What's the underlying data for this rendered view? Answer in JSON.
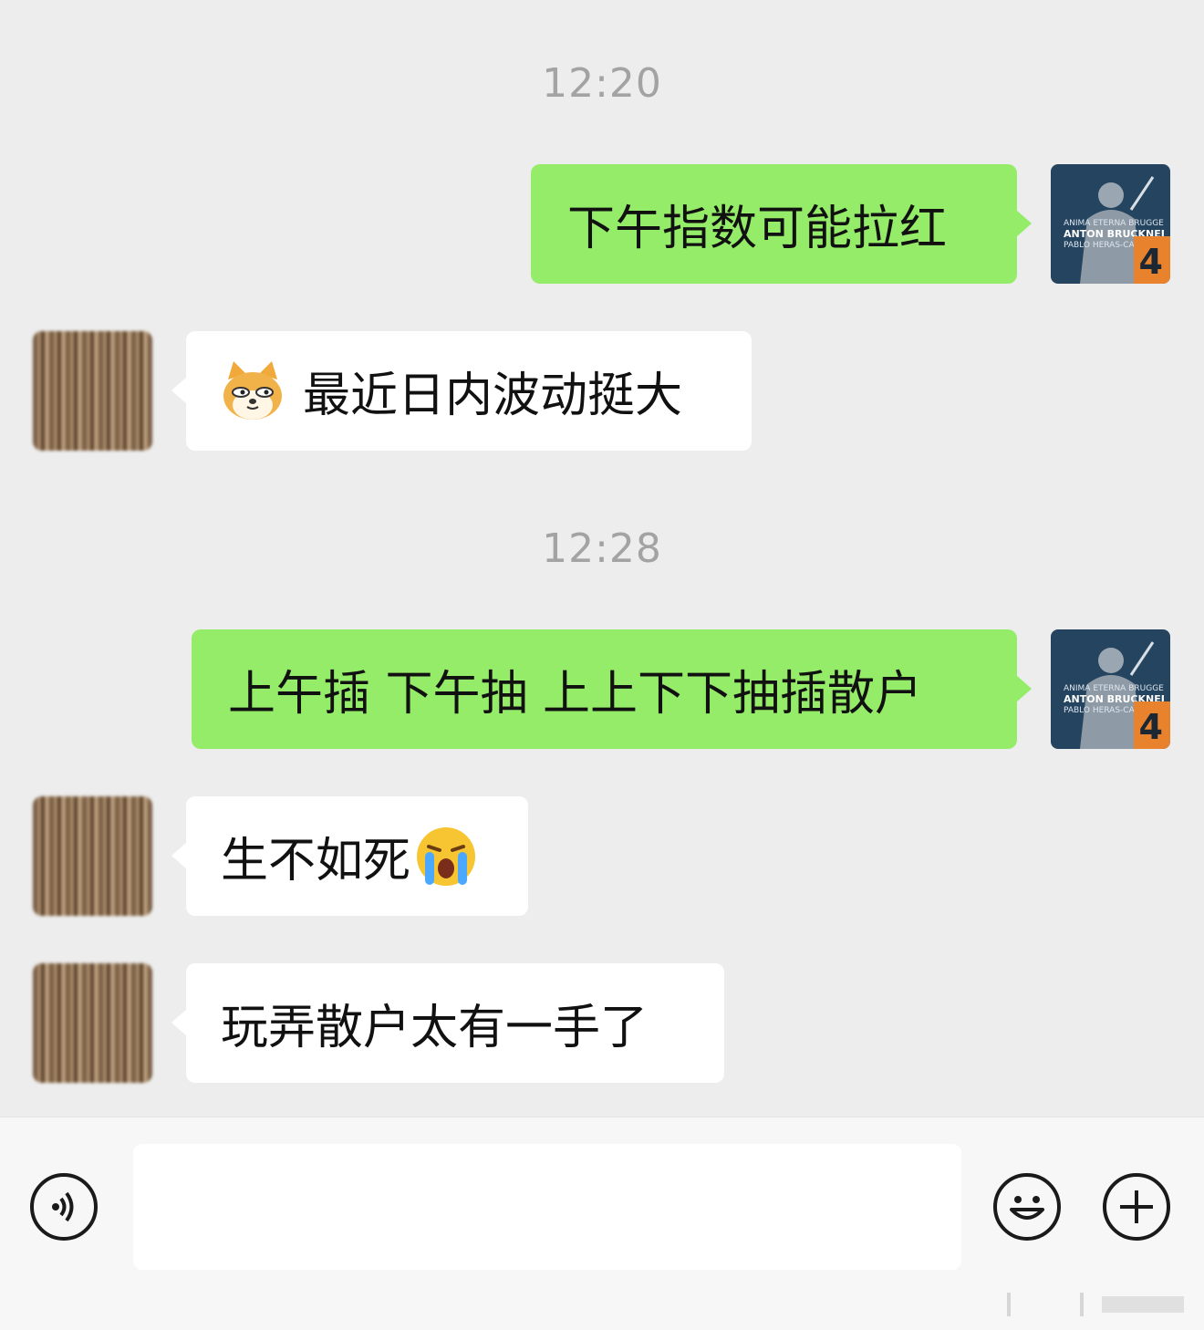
{
  "messages": [
    {
      "kind": "timestamp",
      "text": "12:20"
    },
    {
      "kind": "outgoing",
      "text": "下午指数可能拉红"
    },
    {
      "kind": "incoming",
      "emoji": "doge-cat-emoji",
      "text": "最近日内波动挺大"
    },
    {
      "kind": "timestamp",
      "text": "12:28"
    },
    {
      "kind": "outgoing",
      "text": "上午插 下午抽 上上下下抽插散户"
    },
    {
      "kind": "incoming",
      "text": "生不如死",
      "emoji": "loudly-crying-emoji"
    },
    {
      "kind": "incoming",
      "text": "玩弄散户太有一手了"
    }
  ],
  "self_avatar": {
    "line1": "ANIMA ETERNA BRUGGE",
    "line2": "ANTON BRUCKNER",
    "line3": "PABLO HERAS-CASADO",
    "number": "4"
  },
  "input_bar": {
    "voice_icon": "voice-icon",
    "emoji_icon": "emoji-smile-icon",
    "plus_icon": "plus-icon",
    "input_value": ""
  },
  "colors": {
    "outgoing_bubble": "#95ec69",
    "incoming_bubble": "#ffffff",
    "background": "#ededed"
  }
}
